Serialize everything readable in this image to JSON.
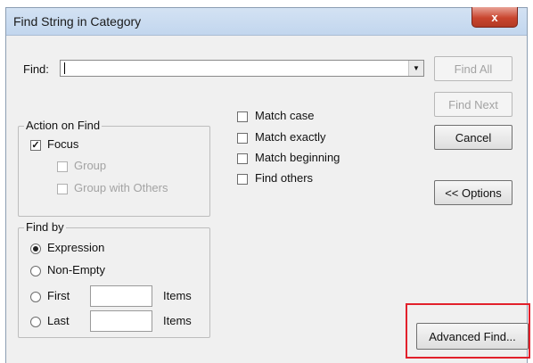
{
  "window": {
    "title": "Find String in Category",
    "close_glyph": "x"
  },
  "find": {
    "label": "Find:",
    "value": "",
    "dropdown_glyph": "▼"
  },
  "buttons": {
    "find_all": "Find All",
    "find_next": "Find Next",
    "cancel": "Cancel",
    "options": "<< Options",
    "advanced_find": "Advanced Find..."
  },
  "action_on_find": {
    "legend": "Action on Find",
    "focus": {
      "label": "Focus",
      "checked": true
    },
    "group": {
      "label": "Group",
      "checked": false,
      "enabled": false
    },
    "group_with_others": {
      "label": "Group with Others",
      "checked": false,
      "enabled": false
    }
  },
  "match_options": {
    "match_case": {
      "label": "Match case",
      "checked": false
    },
    "match_exactly": {
      "label": "Match exactly",
      "checked": false
    },
    "match_beginning": {
      "label": "Match beginning",
      "checked": false
    },
    "find_others": {
      "label": "Find others",
      "checked": false
    }
  },
  "find_by": {
    "legend": "Find by",
    "selected": "Expression",
    "expression": "Expression",
    "non_empty": "Non-Empty",
    "first": "First",
    "last": "Last",
    "first_value": "",
    "last_value": "",
    "items_label": "Items"
  },
  "colors": {
    "highlight": "#e2202b",
    "close_button": "#c9452f"
  },
  "icons": {
    "checkmark": "check-icon",
    "dropdown": "chevron-down-icon",
    "close": "close-icon"
  }
}
